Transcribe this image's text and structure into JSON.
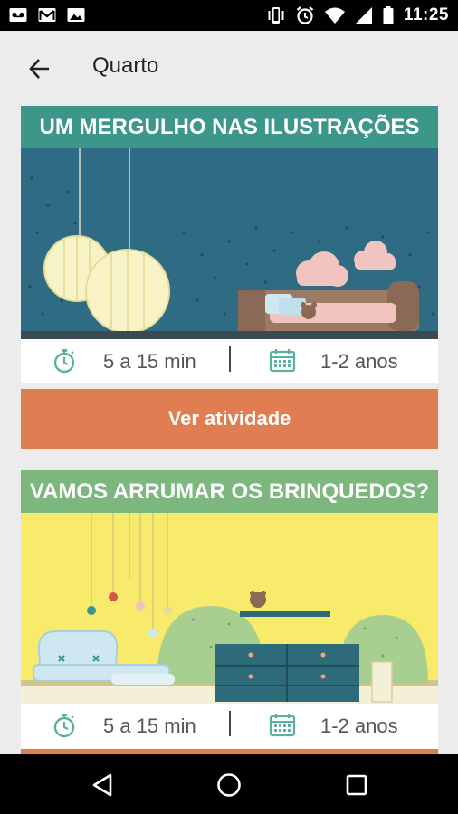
{
  "status_bar": {
    "time": "11:25",
    "left_icons": [
      "voicemail-icon",
      "gmail-icon",
      "image-icon"
    ],
    "right_icons": [
      "vibrate-icon",
      "alarm-icon",
      "wifi-icon",
      "signal-icon",
      "battery-icon"
    ]
  },
  "app_bar": {
    "title": "Quarto",
    "back_icon": "arrow-back-icon"
  },
  "cards": [
    {
      "title": "UM MERGULHO NAS ILUSTRAÇÕES",
      "duration": "5 a 15 min",
      "age": "1-2 anos",
      "button_label": "Ver atividade",
      "colors": {
        "title_bg": "#3c9689",
        "art_bg": "#2f6c84"
      }
    },
    {
      "title": "VAMOS ARRUMAR OS BRINQUEDOS?",
      "duration": "5 a 15 min",
      "age": "1-2 anos",
      "colors": {
        "title_bg": "#7cb87e",
        "art_bg": "#f8ea6a"
      }
    }
  ],
  "colors": {
    "background": "#ececec",
    "accent": "#e07d52",
    "icon_teal": "#5ab29e"
  },
  "nav_bar": {
    "buttons": [
      "back-triangle-icon",
      "home-circle-icon",
      "recents-square-icon"
    ]
  }
}
